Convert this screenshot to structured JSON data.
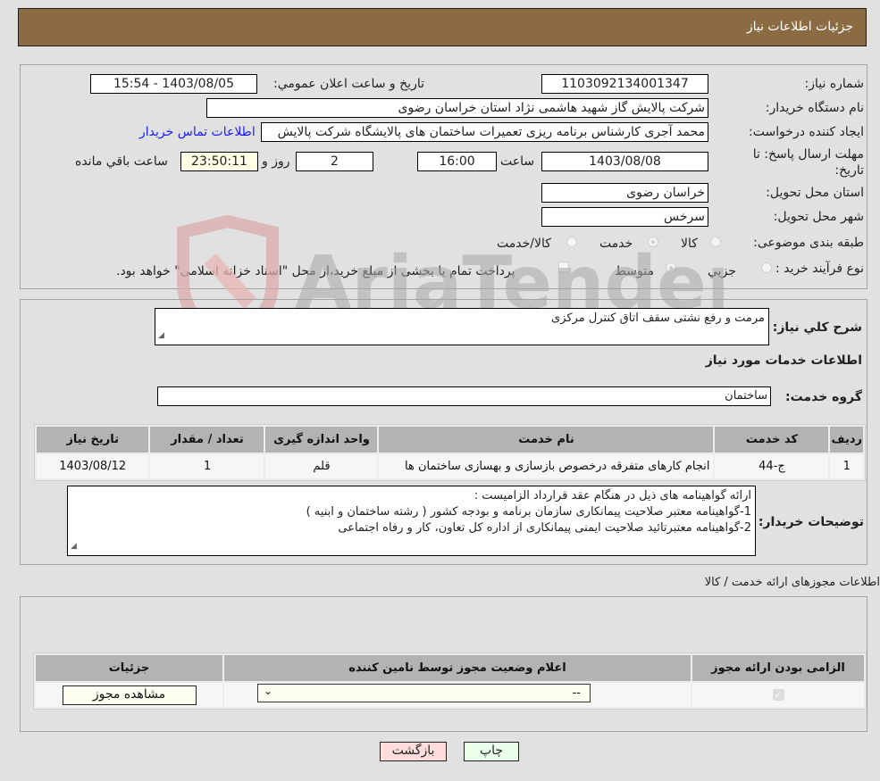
{
  "header": {
    "title": "جزئيات اطلاعات نياز"
  },
  "fields": {
    "need_number_label": "شماره نیاز:",
    "need_number": "1103092134001347",
    "announce_label": "تاریخ و ساعت اعلان عمومي:",
    "announce_value": "1403/08/05 - 15:54",
    "buyer_org_label": "نام دستگاه خریدار:",
    "buyer_org": "شرکت پالایش گاز شهید هاشمی نژاد   استان خراسان رضوی",
    "creator_label": "ایجاد کننده درخواست:",
    "creator": "محمد آجری کارشناس برنامه ریزی تعمیرات ساختمان های پالایشگاه شرکت پالایش",
    "contact_link": "اطلاعات تماس خریدار",
    "deadline_label_1": "مهلت ارسال پاسخ: تا",
    "deadline_label_2": "تاریخ:",
    "deadline_date": "1403/08/08",
    "time_label": "ساعت",
    "deadline_time": "16:00",
    "days": "2",
    "days_label": "روز و",
    "remaining": "23:50:11",
    "remaining_label": "ساعت باقي مانده",
    "province_label": "استان محل تحویل:",
    "province": "خراسان رضوی",
    "city_label": "شهر محل تحویل:",
    "city": "سرخس",
    "category_label": "طبقه بندی موضوعی:",
    "category_options": [
      "کالا",
      "خدمت",
      "کالا/خدمت"
    ],
    "category_selected": "خدمت",
    "process_label": "نوع فرآیند خرید :",
    "process_options": [
      "جزيي",
      "متوسط"
    ],
    "process_selected": "متوسط",
    "treasury_note": "پرداخت تمام یا بخشی از مبلغ خرید،از محل \"اسناد خزانه اسلامی\" خواهد بود."
  },
  "description": {
    "label": "شرح کلي نياز:",
    "value": "مرمت و رفع نشتی سقف اتاق کنترل مرکزی"
  },
  "services": {
    "section_title": "اطلاعات خدمات مورد نياز",
    "group_label": "گروه خدمت:",
    "group_value": "ساختمان",
    "columns": [
      "رديف",
      "کد خدمت",
      "نام خدمت",
      "واحد اندازه گيری",
      "تعداد / مقدار",
      "تاریخ نیاز"
    ],
    "rows": [
      [
        "1",
        "ج-44",
        "انجام کارهای متفرقه درخصوص بازسازی و بهسازی ساختمان ها",
        "قلم",
        "1",
        "1403/08/12"
      ]
    ]
  },
  "buyer_notes": {
    "label": "توضيحات خريدار:",
    "lines": [
      "ارائه گواهینامه های ذیل در هنگام عقد قرارداد الزامیست :",
      "1-گواهینامه معتبر صلاحیت پیمانکاری سازمان برنامه و بودجه کشور ( رشته ساختمان و ابنیه )",
      "2-گواهینامه معتبرتائید صلاحیت ایمنی پیمانکاری از اداره کل تعاون، کار و رفاه اجتماعی"
    ]
  },
  "permits": {
    "section_title": "اطلاعات مجوزهای ارائه خدمت / کالا",
    "columns": [
      "الزامی بودن ارائه مجوز",
      "اعلام وضعیت مجوز توسط نامین کننده",
      "جزئیات"
    ],
    "row": {
      "required": true,
      "status_value": "--",
      "details_button": "مشاهده مجوز"
    }
  },
  "buttons": {
    "print": "چاپ",
    "back": "بازگشت"
  },
  "watermark": "AriaTender.neT",
  "colors": {
    "header": "#8b6b42",
    "link": "#1a1aff",
    "remaining_bg": "#ffffe6",
    "print_bg": "#eaffea",
    "back_bg": "#ffdddd"
  }
}
